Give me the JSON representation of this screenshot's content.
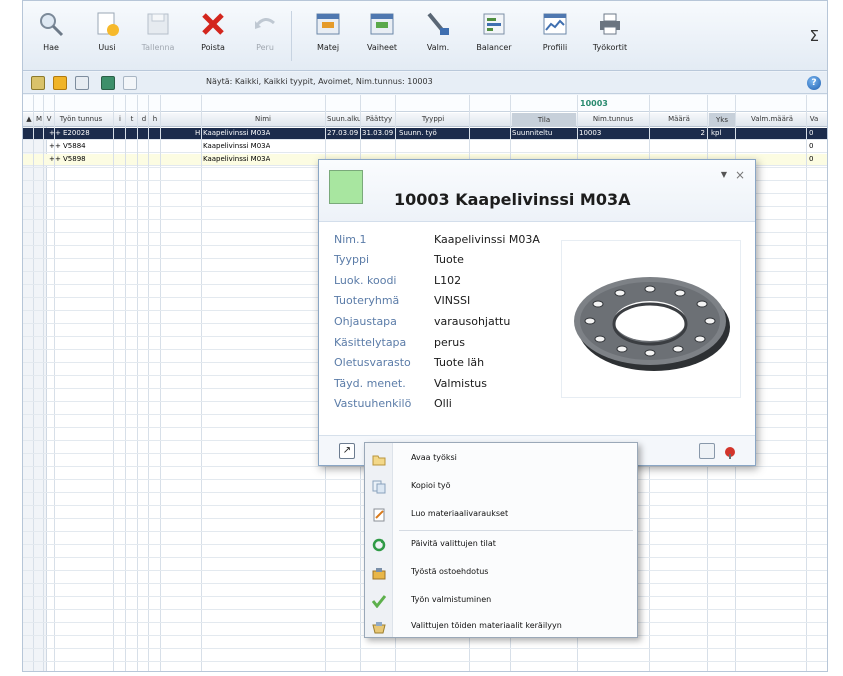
{
  "toolbar": {
    "buttons": [
      {
        "label": "Hae",
        "icon": "search-icon"
      },
      {
        "label": "Uusi",
        "icon": "new-document-icon"
      },
      {
        "label": "Tallenna",
        "icon": "save-icon"
      },
      {
        "label": "Poista",
        "icon": "delete-icon"
      },
      {
        "label": "Peru",
        "icon": "undo-icon"
      },
      {
        "label": "Matej",
        "icon": "materials-window-icon"
      },
      {
        "label": "Vaiheet",
        "icon": "phases-window-icon"
      },
      {
        "label": "Valm.",
        "icon": "manufacture-icon"
      },
      {
        "label": "Balancer",
        "icon": "balancer-icon"
      },
      {
        "label": "Profiili",
        "icon": "profile-chart-icon"
      },
      {
        "label": "Työkortit",
        "icon": "printer-icon"
      }
    ],
    "sigma": "Σ"
  },
  "filter_bar": {
    "text": "Näytä: Kaikki, Kaikki tyypit, Avoimet, Nim.tunnus: 10003"
  },
  "grid": {
    "filter_value": "10003",
    "columns": [
      "M",
      "V",
      "Työn tunnus",
      "i",
      "t",
      "d",
      "h",
      "Nimi",
      "Suun.alku",
      "Päättyy",
      "Tyyppi",
      "Tila",
      "Nim.tunnus",
      "Määrä",
      "Yks",
      "Valm.määrä",
      "Va"
    ],
    "rows": [
      {
        "m": "+",
        "v": "+",
        "id": "E20028",
        "h": "H",
        "name": "Kaapelivinssi M03A",
        "start": "27.03.09",
        "end": "31.03.09",
        "type": "Suunn. työ",
        "status": "Suunniteltu",
        "item": "10003",
        "qty": "2",
        "unit": "kpl",
        "last": "0"
      },
      {
        "m": "+",
        "v": "+",
        "id": "V5884",
        "h": "",
        "name": "Kaapelivinssi M03A",
        "start": "",
        "end": "",
        "type": "",
        "status": "",
        "item": "",
        "qty": "",
        "unit": "",
        "last": "0"
      },
      {
        "m": "+",
        "v": "+",
        "id": "V5898",
        "h": "",
        "name": "Kaapelivinssi M03A",
        "start": "",
        "end": "",
        "type": "",
        "status": "",
        "item": "",
        "qty": "",
        "unit": "",
        "last": "0"
      }
    ]
  },
  "card": {
    "title": "10003  Kaapelivinssi M03A",
    "swatch_color": "#a8e6a0",
    "dropdown": "▼",
    "close": "×",
    "properties": [
      {
        "key": "Nim.1",
        "value": "Kaapelivinssi M03A"
      },
      {
        "key": "Tyyppi",
        "value": "Tuote"
      },
      {
        "key": "Luok. koodi",
        "value": "L102"
      },
      {
        "key": "Tuoteryhmä",
        "value": "VINSSI"
      },
      {
        "key": "Ohjaustapa",
        "value": "varausohjattu"
      },
      {
        "key": "Käsittelytapa",
        "value": "perus"
      },
      {
        "key": "Oletusvarasto",
        "value": "Tuote läh"
      },
      {
        "key": "Täyd. menet.",
        "value": "Valmistus"
      },
      {
        "key": "Vastuuhenkilö",
        "value": "Olli"
      }
    ],
    "image": "flange-ring-image"
  },
  "context_menu": {
    "items": [
      {
        "label": "Avaa työksi",
        "icon": "folder-open-icon"
      },
      {
        "label": "Kopioi työ",
        "icon": "copy-icon"
      },
      {
        "label": "Luo materiaalivaraukset",
        "icon": "document-edit-icon"
      },
      {
        "label": "Päivitä valittujen tilat",
        "icon": "refresh-icon"
      },
      {
        "label": "Työstä ostoehdotus",
        "icon": "purchase-icon"
      },
      {
        "label": "Työn valmistuminen",
        "icon": "checkmark-icon"
      },
      {
        "label": "Valittujen töiden materiaalit keräilyyn",
        "icon": "picking-icon"
      }
    ]
  },
  "colors": {
    "selected_row": "#1c2c4c",
    "highlight_row": "#fcfce2",
    "label_blue": "#5b7ca8",
    "filter_value_green": "#2a8b6f"
  }
}
